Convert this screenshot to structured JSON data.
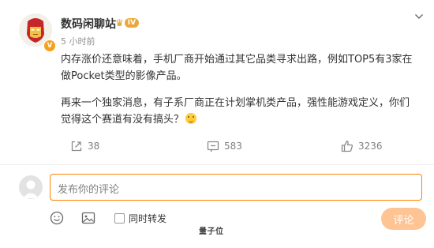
{
  "post": {
    "author": "数码闲聊站",
    "level_badge": "IV",
    "verified_mark": "V",
    "time": "5 小时前",
    "paragraphs": [
      "内存涨价还意味着，手机厂商开始通过其它品类寻求出路，例如TOP5有3家在做Pocket类型的影像产品。",
      "再来一个独家消息，有子系厂商正在计划掌机类产品，强性能游戏定义，你们觉得这个赛道有没有搞头？"
    ],
    "emoji_icon": "grinning-face-icon",
    "actions": {
      "share_count": "38",
      "comment_count": "583",
      "like_count": "3236"
    }
  },
  "comment_box": {
    "placeholder": "发布你的评论",
    "forward_label": "同时转发",
    "submit_label": "评论"
  },
  "watermark": "量子位",
  "colors": {
    "accent": "#ff8200",
    "submit_disabled": "#ffc494",
    "muted_text": "#808080",
    "badge_gold": "#e9a83c"
  }
}
